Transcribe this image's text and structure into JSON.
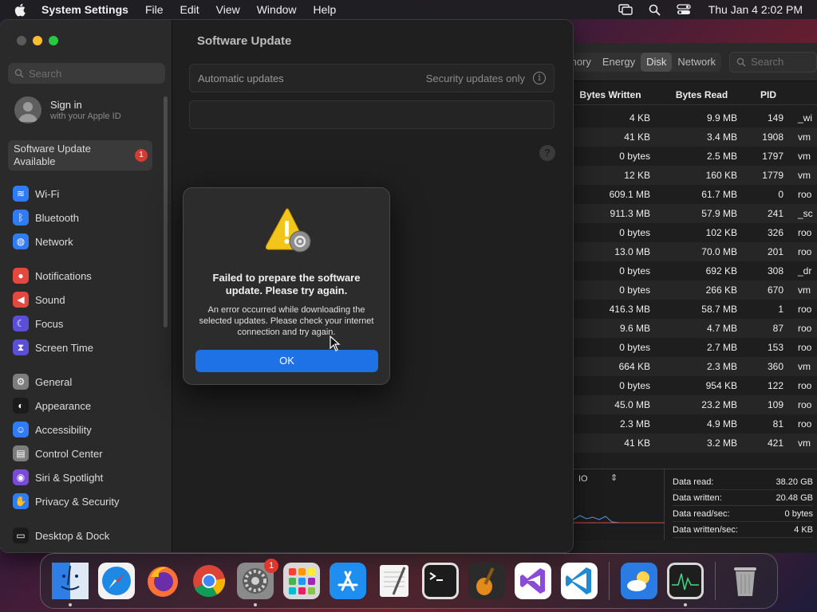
{
  "menubar": {
    "app_name": "System Settings",
    "menus": [
      "File",
      "Edit",
      "View",
      "Window",
      "Help"
    ],
    "clock": "Thu Jan 4  2:02 PM"
  },
  "activity_monitor": {
    "tabs": [
      "mory",
      "Energy",
      "Disk",
      "Network"
    ],
    "selected_tab": "Disk",
    "search_placeholder": "Search",
    "columns": [
      "Bytes Written",
      "Bytes Read",
      "PID"
    ],
    "rows": [
      {
        "written": "4 KB",
        "read": "9.9 MB",
        "pid": "149",
        "user": "_wi"
      },
      {
        "written": "41 KB",
        "read": "3.4 MB",
        "pid": "1908",
        "user": "vm"
      },
      {
        "written": "0 bytes",
        "read": "2.5 MB",
        "pid": "1797",
        "user": "vm"
      },
      {
        "written": "12 KB",
        "read": "160 KB",
        "pid": "1779",
        "user": "vm"
      },
      {
        "written": "609.1 MB",
        "read": "61.7 MB",
        "pid": "0",
        "user": "roo"
      },
      {
        "written": "911.3 MB",
        "read": "57.9 MB",
        "pid": "241",
        "user": "_sc"
      },
      {
        "written": "0 bytes",
        "read": "102 KB",
        "pid": "326",
        "user": "roo"
      },
      {
        "written": "13.0 MB",
        "read": "70.0 MB",
        "pid": "201",
        "user": "roo"
      },
      {
        "written": "0 bytes",
        "read": "692 KB",
        "pid": "308",
        "user": "_dr"
      },
      {
        "written": "0 bytes",
        "read": "266 KB",
        "pid": "670",
        "user": "vm"
      },
      {
        "written": "416.3 MB",
        "read": "58.7 MB",
        "pid": "1",
        "user": "roo"
      },
      {
        "written": "9.6 MB",
        "read": "4.7 MB",
        "pid": "87",
        "user": "roo"
      },
      {
        "written": "0 bytes",
        "read": "2.7 MB",
        "pid": "153",
        "user": "roo"
      },
      {
        "written": "664 KB",
        "read": "2.3 MB",
        "pid": "360",
        "user": "vm"
      },
      {
        "written": "0 bytes",
        "read": "954 KB",
        "pid": "122",
        "user": "roo"
      },
      {
        "written": "45.0 MB",
        "read": "23.2 MB",
        "pid": "109",
        "user": "roo"
      },
      {
        "written": "2.3 MB",
        "read": "4.9 MB",
        "pid": "81",
        "user": "roo"
      },
      {
        "written": "41 KB",
        "read": "3.2 MB",
        "pid": "421",
        "user": "vm"
      }
    ],
    "graph_label": "IO",
    "stats": [
      {
        "label": "Data read:",
        "value": "38.20 GB"
      },
      {
        "label": "Data written:",
        "value": "20.48 GB"
      },
      {
        "label": "Data read/sec:",
        "value": "0 bytes"
      },
      {
        "label": "Data written/sec:",
        "value": "4 KB"
      }
    ]
  },
  "settings": {
    "search_placeholder": "Search",
    "signin_title": "Sign in",
    "signin_sub": "with your Apple ID",
    "update_available": "Software Update Available",
    "update_badge": "1",
    "groups": [
      [
        {
          "label": "Wi-Fi",
          "icon": "wifi-icon",
          "color": "#2f7cf6"
        },
        {
          "label": "Bluetooth",
          "icon": "bluetooth-icon",
          "color": "#2f7cf6"
        },
        {
          "label": "Network",
          "icon": "globe-icon",
          "color": "#2f7cf6"
        }
      ],
      [
        {
          "label": "Notifications",
          "icon": "bell-icon",
          "color": "#e5483e"
        },
        {
          "label": "Sound",
          "icon": "speaker-icon",
          "color": "#e5483e"
        },
        {
          "label": "Focus",
          "icon": "moon-icon",
          "color": "#5b4fd8"
        },
        {
          "label": "Screen Time",
          "icon": "hourglass-icon",
          "color": "#5b4fd8"
        }
      ],
      [
        {
          "label": "General",
          "icon": "gear-icon",
          "color": "#7d7d7d"
        },
        {
          "label": "Appearance",
          "icon": "appearance-icon",
          "color": "#1b1b1b"
        },
        {
          "label": "Accessibility",
          "icon": "accessibility-icon",
          "color": "#2f7cf6"
        },
        {
          "label": "Control Center",
          "icon": "control-center-icon",
          "color": "#7d7d7d"
        },
        {
          "label": "Siri & Spotlight",
          "icon": "siri-icon",
          "color": "#7a4bd8"
        },
        {
          "label": "Privacy & Security",
          "icon": "hand-icon",
          "color": "#2f7cf6"
        }
      ],
      [
        {
          "label": "Desktop & Dock",
          "icon": "dock-icon",
          "color": "#1b1b1b"
        }
      ]
    ],
    "main_title": "Software Update",
    "auto_updates_label": "Automatic updates",
    "auto_updates_value": "Security updates only",
    "help_glyph": "?"
  },
  "alert": {
    "title": "Failed to prepare the software update. Please try again.",
    "message": "An error occurred while downloading the selected updates. Please check your internet connection and try again.",
    "ok_label": "OK"
  },
  "dock": {
    "apps": [
      {
        "name": "finder",
        "color": "#3a8ef6",
        "running": true
      },
      {
        "name": "safari",
        "color": "#1e88e5",
        "running": false
      },
      {
        "name": "firefox",
        "color": "#6a2ea8",
        "running": false
      },
      {
        "name": "chrome",
        "color": "#ffffff",
        "running": false
      },
      {
        "name": "system-settings",
        "color": "#8a8a8a",
        "running": true,
        "badge": "1"
      },
      {
        "name": "launchpad",
        "color": "#d8d8d8",
        "running": false
      },
      {
        "name": "app-store",
        "color": "#1f8ef1",
        "running": false
      },
      {
        "name": "textedit",
        "color": "#f4f4f4",
        "running": false
      },
      {
        "name": "terminal",
        "color": "#1c1c1c",
        "running": false
      },
      {
        "name": "garageband",
        "color": "#2b2b2b",
        "running": false
      },
      {
        "name": "visual-studio",
        "color": "#ffffff",
        "running": false
      },
      {
        "name": "vscode",
        "color": "#ffffff",
        "running": false
      }
    ],
    "extras": [
      {
        "name": "weather",
        "color": "#2b7be4",
        "running": false
      },
      {
        "name": "activity-monitor",
        "color": "#1e1e1e",
        "running": true
      }
    ],
    "trash": {
      "name": "trash"
    }
  }
}
